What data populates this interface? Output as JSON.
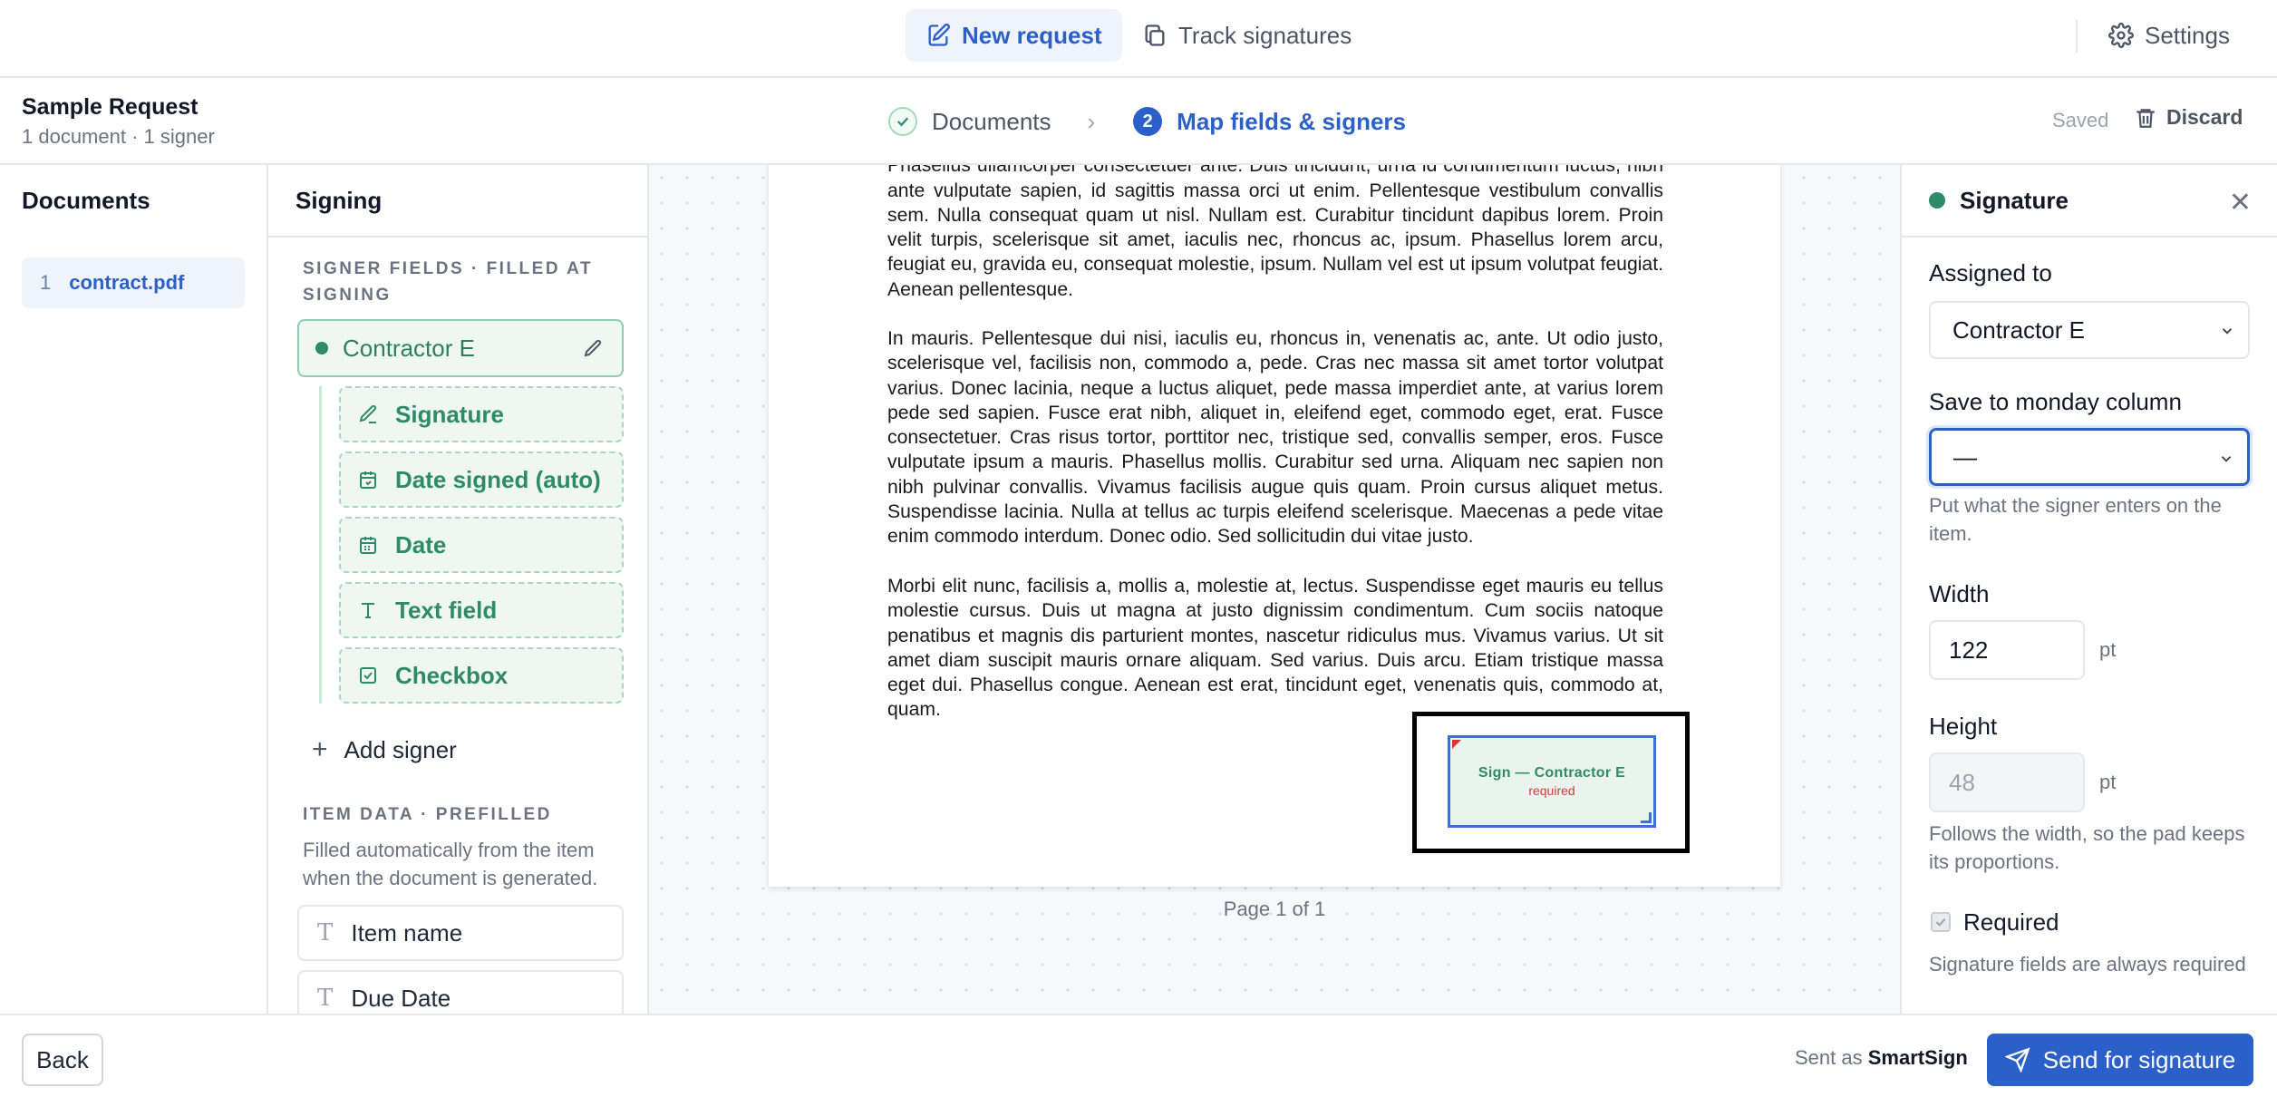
{
  "topnav": {
    "new_request": "New request",
    "track_signatures": "Track signatures",
    "settings": "Settings"
  },
  "header": {
    "title": "Sample Request",
    "subtitle": "1 document · 1 signer",
    "steps": [
      {
        "label": "Documents",
        "state": "done"
      },
      {
        "number": "2",
        "label": "Map fields & signers",
        "state": "active"
      }
    ],
    "saved": "Saved",
    "discard": "Discard"
  },
  "documents": {
    "title": "Documents",
    "items": [
      {
        "index": "1",
        "name": "contract.pdf"
      }
    ]
  },
  "signing": {
    "title": "Signing",
    "signer_fields_label": "SIGNER FIELDS · FILLED AT",
    "signer_fields_label2": "SIGNING",
    "signer": "Contractor E",
    "fields": [
      {
        "label": "Signature",
        "icon": "pen-icon"
      },
      {
        "label": "Date signed (auto)",
        "icon": "calendar-icon"
      },
      {
        "label": "Date",
        "icon": "calendar-grid-icon"
      },
      {
        "label": "Text field",
        "icon": "text-icon"
      },
      {
        "label": "Checkbox",
        "icon": "checkbox-icon"
      }
    ],
    "add_signer": "Add signer",
    "item_data_label": "ITEM DATA · PREFILLED",
    "item_data_help": "Filled automatically from the item when the document is generated.",
    "item_data": [
      {
        "label": "Item name"
      },
      {
        "label": "Due Date"
      }
    ]
  },
  "document": {
    "paragraphs": [
      "lobortis tortor, sed vestibulum dui metus venenatis est. Nunc cursus ligula. Nulla facilisi. Phasellus ullamcorper consectetuer ante. Duis tincidunt, urna id condimentum luctus, nibh ante vulputate sapien, id sagittis massa orci ut enim. Pellentesque vestibulum convallis sem. Nulla consequat quam ut nisl. Nullam est. Curabitur tincidunt dapibus lorem. Proin velit turpis, scelerisque sit amet, iaculis nec, rhoncus ac, ipsum. Phasellus lorem arcu, feugiat eu, gravida eu, consequat molestie, ipsum. Nullam vel est ut ipsum volutpat feugiat. Aenean pellentesque.",
      "In mauris. Pellentesque dui nisi, iaculis eu, rhoncus in, venenatis ac, ante. Ut odio justo, scelerisque vel, facilisis non, commodo a, pede. Cras nec massa sit amet tortor volutpat varius. Donec lacinia, neque a luctus aliquet, pede massa imperdiet ante, at varius lorem pede sed sapien. Fusce erat nibh, aliquet in, eleifend eget, commodo eget, erat. Fusce consectetuer. Cras risus tortor, porttitor nec, tristique sed, convallis semper, eros. Fusce vulputate ipsum a mauris. Phasellus mollis. Curabitur sed urna. Aliquam nec sapien non nibh pulvinar convallis. Vivamus facilisis augue quis quam. Proin cursus aliquet metus. Suspendisse lacinia. Nulla at tellus ac turpis eleifend scelerisque. Maecenas a pede vitae enim commodo interdum. Donec odio. Sed sollicitudin dui vitae justo.",
      "Morbi elit nunc, facilisis a, mollis a, molestie at, lectus. Suspendisse eget mauris eu tellus molestie cursus. Duis ut magna at justo dignissim condimentum. Cum sociis natoque penatibus et magnis dis parturient montes, nascetur ridiculus mus. Vivamus varius. Ut sit amet diam suscipit mauris ornare aliquam. Sed varius. Duis arcu. Etiam tristique massa eget dui. Phasellus congue. Aenean est erat, tincidunt eget, venenatis quis, commodo at, quam."
    ],
    "sig_field_label": "Sign — Contractor E",
    "sig_field_required": "required",
    "page_indicator": "Page 1 of 1"
  },
  "properties": {
    "title": "Signature",
    "assigned_to_label": "Assigned to",
    "assigned_to_value": "Contractor E",
    "save_column_label": "Save to monday column",
    "save_column_value": "—",
    "save_column_help": "Put what the signer enters on the item.",
    "width_label": "Width",
    "width_value": "122",
    "width_unit": "pt",
    "height_label": "Height",
    "height_value": "48",
    "height_unit": "pt",
    "height_help": "Follows the width, so the pad keeps its proportions.",
    "required_label": "Required",
    "required_checked": true,
    "required_help": "Signature fields are always required"
  },
  "footer": {
    "back": "Back",
    "sent_as_prefix": "Sent as",
    "sent_as_name": "SmartSign",
    "send": "Send for signature"
  },
  "colors": {
    "accent": "#2b5fc9",
    "signer_green": "#2e8a69"
  }
}
